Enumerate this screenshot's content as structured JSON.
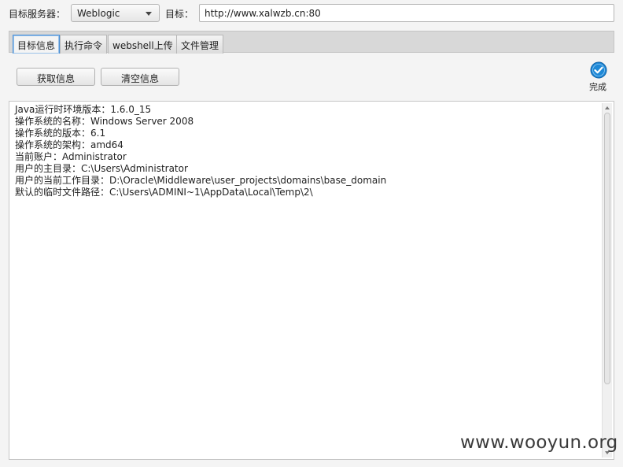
{
  "toolbar": {
    "server_label": "目标服务器：",
    "server_select": "Weblogic",
    "target_label": "目标：",
    "target_url": "http://www.xalwzb.cn:80"
  },
  "tabs": [
    {
      "label": "目标信息",
      "active": true
    },
    {
      "label": "执行命令",
      "active": false
    },
    {
      "label": "webshell上传",
      "active": false
    },
    {
      "label": "文件管理",
      "active": false
    }
  ],
  "actions": {
    "get_info": "获取信息",
    "clear_info": "清空信息"
  },
  "status": {
    "label": "完成",
    "icon": "check-circle-icon",
    "color": "#1e88d6"
  },
  "output": {
    "lines": [
      "Java运行时环境版本：1.6.0_15",
      "操作系统的名称：Windows Server 2008",
      "操作系统的版本：6.1",
      "操作系统的架构：amd64",
      "当前账户：Administrator",
      "用户的主目录：C:\\Users\\Administrator",
      "用户的当前工作目录：D:\\Oracle\\Middleware\\user_projects\\domains\\base_domain",
      "默认的临时文件路径：C:\\Users\\ADMINI~1\\AppData\\Local\\Temp\\2\\"
    ]
  },
  "watermark": "www.wooyun.org"
}
